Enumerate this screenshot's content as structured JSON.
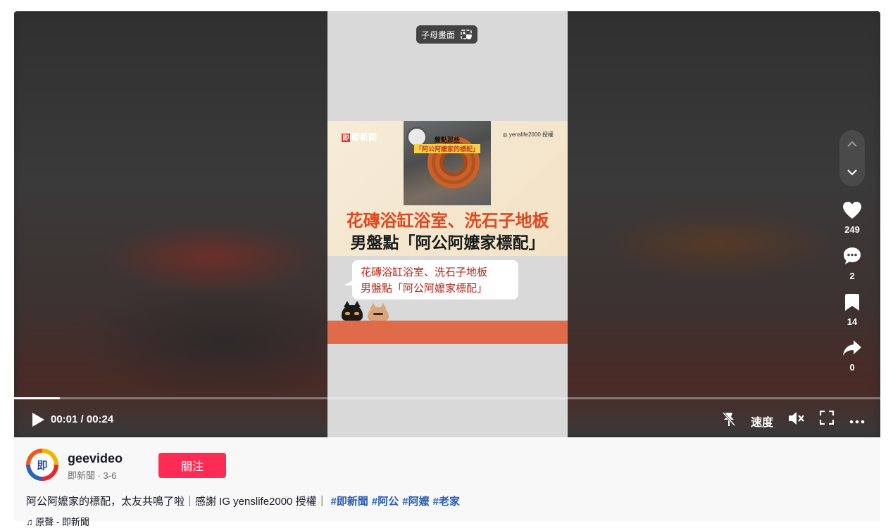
{
  "player": {
    "pip_label": "子母畫面",
    "thumbnail": {
      "brand": "即新聞",
      "brand_short": "即",
      "photo_caption_line1": "盤點那些",
      "photo_caption_line2": "「阿公阿嬤家的標配」",
      "ig_credit": "yenslife2000 授權",
      "headline_line1": "花磚浴缸浴室、洗石子地板",
      "headline_line2": "男盤點「阿公阿嬤家標配」"
    },
    "bubble_line1": "花磚浴缸浴室、洗石子地板",
    "bubble_line2": "男盤點「阿公阿嬤家標配」",
    "progress_fraction": 0.053,
    "current_time": "00:01",
    "duration": "00:24",
    "time_display": "00:01 / 00:24",
    "speed_label": "速度"
  },
  "actions": {
    "likes": "249",
    "comments": "2",
    "saves": "14",
    "shares": "0"
  },
  "author": {
    "username": "geevideo",
    "meta": "即新聞 · 3-6",
    "avatar_text": "即",
    "follow_label": "關注"
  },
  "description": {
    "text": "阿公阿嬤家的標配，太友共鳴了啦｜感謝 IG yenslife2000 授權｜",
    "hashtags": [
      "#即新聞",
      "#阿公",
      "#阿嬤",
      "#老家"
    ]
  },
  "music": {
    "label": "♫ 原聲 - 即新聞"
  },
  "colors": {
    "follow_button": "#fe2c55",
    "hashtag": "#2b5db4",
    "headline_accent": "#e2471e",
    "orange_band": "#df6b4a"
  }
}
